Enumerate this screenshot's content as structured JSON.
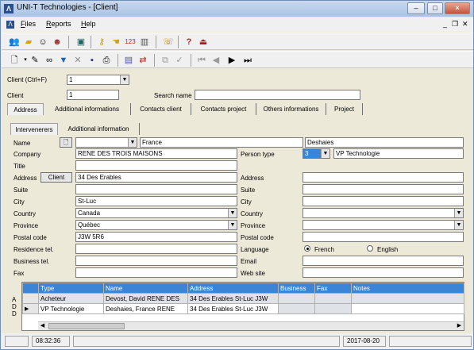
{
  "window": {
    "title": "UNI-T Technologies - [Client]"
  },
  "menu": {
    "items": [
      "Files",
      "Reports",
      "Help"
    ]
  },
  "toolbar1": {
    "icons": [
      "people-icon",
      "folder-icon",
      "user-hat-icon",
      "user-group-icon",
      "monitor-icon",
      "key-icon",
      "hand-icon",
      "numbers-icon",
      "chart-icon",
      "phone-icon",
      "help-icon",
      "exit-icon"
    ]
  },
  "toolbar2": {
    "icons": [
      "new-icon",
      "dropdown-icon",
      "erase-icon",
      "binoculars-icon",
      "filter-icon",
      "clear-filter-icon",
      "save-icon",
      "print-icon",
      "card-icon",
      "convert-icon",
      "copy-icon",
      "check-icon",
      "first-icon",
      "prev-icon",
      "next-icon",
      "last-icon"
    ]
  },
  "client_selector": {
    "label": "Client (Ctrl+F)",
    "value": "1"
  },
  "client_field": {
    "label": "Client",
    "value": "1"
  },
  "search_name": {
    "label": "Search name",
    "value": ""
  },
  "main_tabs": [
    "Address",
    "Additional informations",
    "Contacts client",
    "Contacts project",
    "Others informations",
    "Project"
  ],
  "sub_tabs": [
    "Intervenerers",
    "Additional information"
  ],
  "form": {
    "name_label": "Name",
    "first_name": "France",
    "last_name": "Deshaies",
    "company_label": "Company",
    "company": "RENE DES TROIS MAISONS",
    "person_type_label": "Person type",
    "person_type_code": "3",
    "person_type_name": "VP Technologie",
    "title_label": "Title",
    "address_label": "Address",
    "client_button": "Client",
    "address": "34 Des Erables",
    "suite_label": "Suite",
    "city_label": "City",
    "city": "St-Luc",
    "country_label": "Country",
    "country": "Canada",
    "province_label": "Province",
    "province": "Québec",
    "postal_label": "Postal code",
    "postal": "J3W 5R6",
    "res_tel_label": "Residence tel.",
    "bus_tel_label": "Business tel.",
    "fax_label": "Fax",
    "r_address_label": "Address",
    "r_suite_label": "Suite",
    "r_city_label": "City",
    "r_country_label": "Country",
    "r_province_label": "Province",
    "r_postal_label": "Postal code",
    "language_label": "Language",
    "lang_french": "French",
    "lang_english": "English",
    "email_label": "Email",
    "website_label": "Web site"
  },
  "grid": {
    "side_label": "ADD",
    "columns": [
      "Type",
      "Name",
      "Address",
      "Business",
      "Fax",
      "Notes"
    ],
    "rows": [
      [
        "Acheteur",
        "Devost, David RENE DES",
        "34 Des Erables St-Luc J3W",
        "",
        "",
        ""
      ],
      [
        "VP Technologie",
        "Deshaies, France RENE",
        "34 Des Erables St-Luc J3W",
        "",
        "",
        ""
      ]
    ]
  },
  "status": {
    "time": "08:32:36",
    "date": "2017-08-20"
  }
}
